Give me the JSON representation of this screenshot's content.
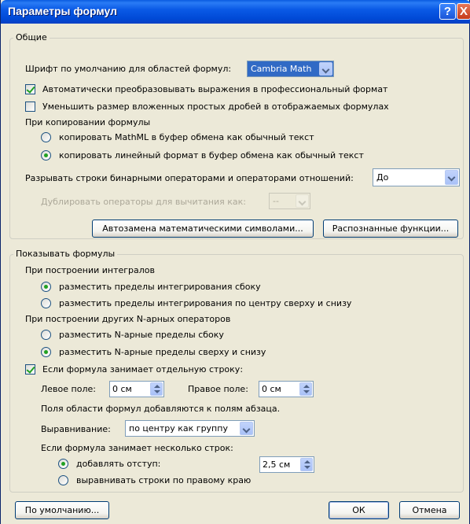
{
  "window": {
    "title": "Параметры формул",
    "help_glyph": "?",
    "close_glyph": "X"
  },
  "general": {
    "legend": "Общие",
    "default_font_label": "Шрифт по умолчанию для областей формул:",
    "default_font_value": "Cambria Math",
    "auto_convert_label": "Автоматически преобразовывать выражения в профессиональный формат",
    "auto_convert_checked": true,
    "reduce_fractions_label": "Уменьшить размер вложенных простых дробей в отображаемых формулах",
    "reduce_fractions_checked": false,
    "copy_heading": "При копировании формулы",
    "copy_mathml_label": "копировать MathML в буфер обмена как обычный текст",
    "copy_linear_label": "копировать линейный формат в буфер обмена как обычный текст",
    "copy_selected": "linear",
    "break_lines_label": "Разрывать строки бинарными операторами и операторами отношений:",
    "break_lines_value": "До",
    "duplicate_minus_label": "Дублировать операторы для вычитания как:",
    "duplicate_minus_value": "--",
    "autocorrect_button": "Автозамена математическими символами...",
    "recognized_functions_button": "Распознанные функции..."
  },
  "display": {
    "legend": "Показывать формулы",
    "integrals_heading": "При построении интегралов",
    "integrals_side_label": "разместить пределы интегрирования сбоку",
    "integrals_center_label": "разместить пределы интегрирования по центру сверху и снизу",
    "integrals_selected": "side",
    "nary_heading": "При построении других N-арных операторов",
    "nary_side_label": "разместить N-арные пределы сбоку",
    "nary_above_label": "разместить N-арные пределы сверху и снизу",
    "nary_selected": "above",
    "own_line_label": "Если формула занимает отдельную строку:",
    "own_line_checked": true,
    "left_margin_label": "Левое поле:",
    "left_margin_value": "0 см",
    "right_margin_label": "Правое поле:",
    "right_margin_value": "0 см",
    "margins_note": "Поля области формул добавляются к полям абзаца.",
    "alignment_label": "Выравнивание:",
    "alignment_value": "по центру как группу",
    "multiline_heading": "Если формула занимает несколько строк:",
    "indent_label": "добавлять отступ:",
    "indent_value": "2,5 см",
    "align_right_label": "выравнивать строки по правому краю",
    "multiline_selected": "indent"
  },
  "footer": {
    "defaults_button": "По умолчанию...",
    "ok_button": "ОК",
    "cancel_button": "Отмена"
  }
}
